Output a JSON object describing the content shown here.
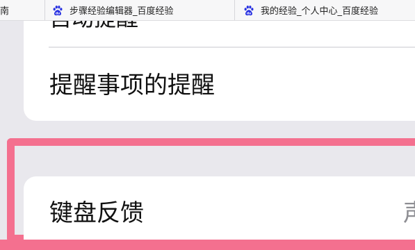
{
  "browser": {
    "tabs": [
      {
        "title": "南",
        "icon": "baidu-paw-icon"
      },
      {
        "title": "步骤经验编辑器_百度经验",
        "icon": "baidu-paw-icon"
      },
      {
        "title": "我的经验_个人中心_百度经验",
        "icon": "baidu-paw-icon"
      }
    ]
  },
  "settings": {
    "partial_row_label": "自动提醒",
    "reminder_row_label": "提醒事项的提醒",
    "keyboard_row_label": "键盘反馈",
    "keyboard_row_value": "声"
  },
  "colors": {
    "page_background": "#e9e8ed",
    "card_background": "#ffffff",
    "highlight_border": "#f4708f",
    "favicon_blue": "#2932e1"
  }
}
